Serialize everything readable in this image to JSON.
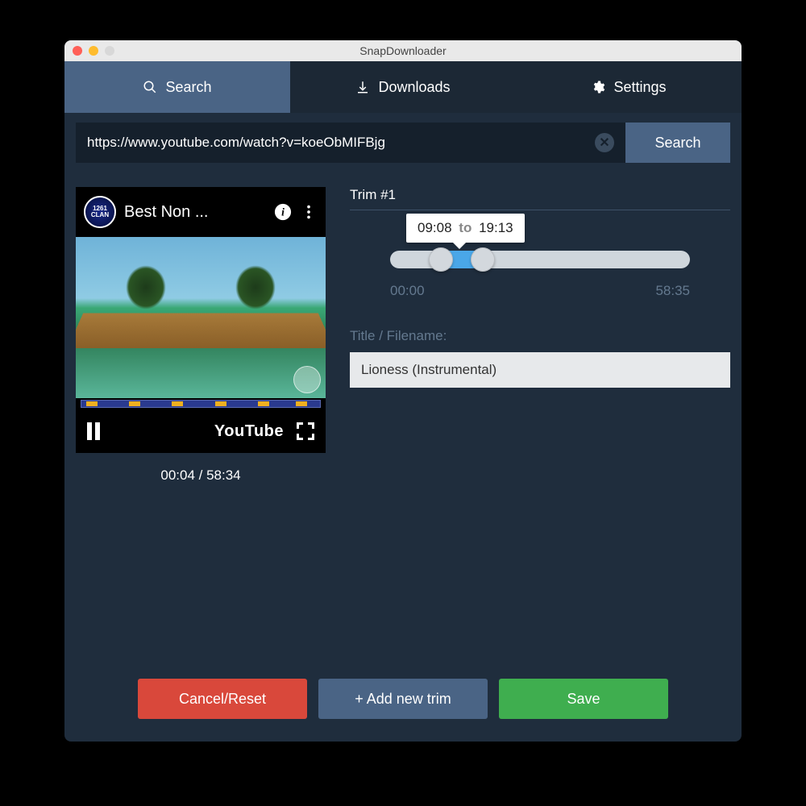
{
  "window": {
    "title": "SnapDownloader"
  },
  "tabs": {
    "search": "Search",
    "downloads": "Downloads",
    "settings": "Settings"
  },
  "search": {
    "url": "https://www.youtube.com/watch?v=koeObMIFBjg",
    "button": "Search"
  },
  "player": {
    "title": "Best Non ...",
    "youtube_label": "YouTube",
    "time_text": "00:04 / 58:34"
  },
  "trim": {
    "heading": "Trim #1",
    "from": "09:08",
    "to_label": "to",
    "to": "19:13",
    "start_label": "00:00",
    "end_label": "58:35",
    "title_label": "Title / Filename:",
    "title_value": "Lioness (Instrumental)"
  },
  "footer": {
    "cancel": "Cancel/Reset",
    "add": "+ Add new trim",
    "save": "Save"
  }
}
